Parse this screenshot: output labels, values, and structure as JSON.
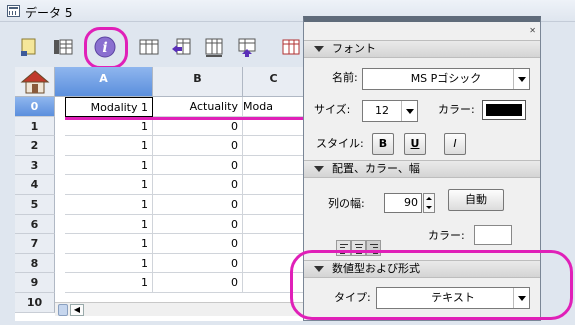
{
  "window": {
    "title": "データ 5"
  },
  "toolbar": {
    "icons": [
      "note-icon",
      "table-icon",
      "info-icon",
      "columns-icon",
      "insert-column-left-icon",
      "delete-column-icon",
      "insert-column-up-icon",
      "table-red-icon"
    ]
  },
  "grid": {
    "columns": [
      "A",
      "B",
      "C"
    ],
    "selected_column": "A",
    "row_numbers": [
      "0",
      "1",
      "2",
      "3",
      "4",
      "5",
      "6",
      "7",
      "8",
      "9",
      "10"
    ],
    "header_row": [
      "Modality 1",
      "Actuality",
      "Moda"
    ],
    "rows": [
      [
        "1",
        "0",
        ""
      ],
      [
        "1",
        "0",
        ""
      ],
      [
        "1",
        "0",
        ""
      ],
      [
        "1",
        "0",
        ""
      ],
      [
        "1",
        "0",
        ""
      ],
      [
        "1",
        "0",
        ""
      ],
      [
        "1",
        "0",
        ""
      ],
      [
        "1",
        "0",
        ""
      ],
      [
        "1",
        "0",
        ""
      ]
    ]
  },
  "panel": {
    "font_section": "フォント",
    "name_label": "名前:",
    "name_value": "MS Pゴシック",
    "size_label": "サイズ:",
    "size_value": "12",
    "color_label": "カラー:",
    "style_label": "スタイル:",
    "style_bold": "B",
    "style_underline": "U",
    "style_italic": "I",
    "layout_section": "配置、カラー、幅",
    "width_label": "列の幅:",
    "width_value": "90",
    "auto_button": "自動",
    "color2_label": "カラー:",
    "number_section": "数値型および形式",
    "type_label": "タイプ:",
    "type_value": "テキスト"
  },
  "colors": {
    "highlight": "#e020b8",
    "selected_header": "#5b8fdd",
    "font_color": "#000000",
    "cell_color": "#ffffff"
  }
}
